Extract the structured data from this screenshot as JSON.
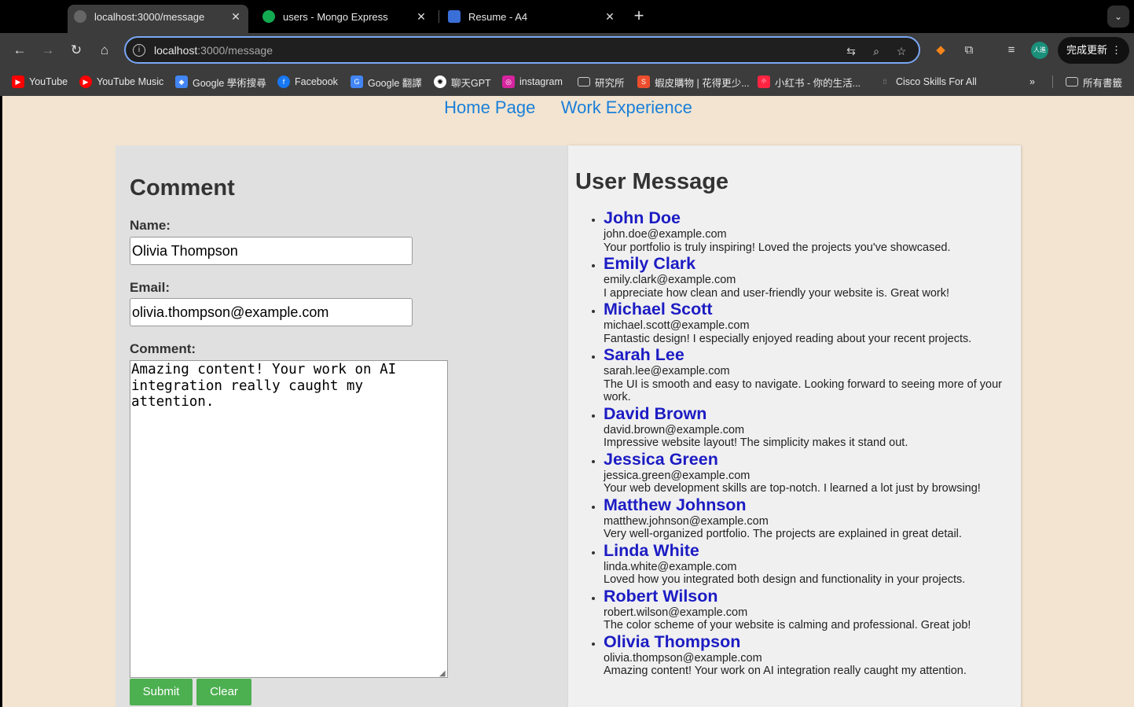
{
  "browser": {
    "tabs": [
      {
        "title": "localhost:3000/message",
        "active": true,
        "favicon": "globe-icon"
      },
      {
        "title": "users - Mongo Express",
        "active": false,
        "favicon": "mongo-leaf-icon"
      },
      {
        "title": "Resume - A4",
        "active": false,
        "favicon": "doc-icon"
      }
    ],
    "url_host": "localhost",
    "url_path": ":3000/message",
    "update_button": "完成更新",
    "profile_initials": "人進",
    "bookmarks": [
      {
        "label": "YouTube",
        "icon": "youtube-icon",
        "color": "#ff0000"
      },
      {
        "label": "YouTube Music",
        "icon": "youtube-music-icon",
        "color": "#ff0000"
      },
      {
        "label": "Google 學術搜尋",
        "icon": "scholar-icon",
        "color": "#4285f4"
      },
      {
        "label": "Facebook",
        "icon": "facebook-icon",
        "color": "#1877f2"
      },
      {
        "label": "Google 翻譯",
        "icon": "translate-icon",
        "color": "#4285f4"
      },
      {
        "label": "聊天GPT",
        "icon": "chatgpt-icon",
        "color": "#ffffff"
      },
      {
        "label": "instagram",
        "icon": "instagram-icon",
        "color": "#d6249f"
      },
      {
        "label": "研究所",
        "icon": "folder-icon",
        "color": "#cccccc"
      },
      {
        "label": "蝦皮購物 | 花得更少...",
        "icon": "shopee-icon",
        "color": "#ee4d2d"
      },
      {
        "label": "小红书 - 你的生活...",
        "icon": "xiaohongshu-icon",
        "color": "#ff2442"
      },
      {
        "label": "Cisco Skills For All",
        "icon": "cisco-icon",
        "color": "#888888"
      }
    ],
    "all_bookmarks": "所有書籤"
  },
  "page": {
    "nav": {
      "home": "Home Page",
      "work": "Work Experience"
    },
    "form": {
      "title": "Comment",
      "name_label": "Name:",
      "name_value": "Olivia Thompson",
      "email_label": "Email:",
      "email_value": "olivia.thompson@example.com",
      "comment_label": "Comment:",
      "comment_value": "Amazing content! Your work on AI integration really caught my attention.",
      "submit": "Submit",
      "clear": "Clear"
    },
    "messages_title": "User Message",
    "messages": [
      {
        "name": "John Doe",
        "email": "john.doe@example.com",
        "text": "Your portfolio is truly inspiring! Loved the projects you've showcased."
      },
      {
        "name": "Emily Clark",
        "email": "emily.clark@example.com",
        "text": "I appreciate how clean and user-friendly your website is. Great work!"
      },
      {
        "name": "Michael Scott",
        "email": "michael.scott@example.com",
        "text": "Fantastic design! I especially enjoyed reading about your recent projects."
      },
      {
        "name": "Sarah Lee",
        "email": "sarah.lee@example.com",
        "text": "The UI is smooth and easy to navigate. Looking forward to seeing more of your work."
      },
      {
        "name": "David Brown",
        "email": "david.brown@example.com",
        "text": "Impressive website layout! The simplicity makes it stand out."
      },
      {
        "name": "Jessica Green",
        "email": "jessica.green@example.com",
        "text": "Your web development skills are top-notch. I learned a lot just by browsing!"
      },
      {
        "name": "Matthew Johnson",
        "email": "matthew.johnson@example.com",
        "text": "Very well-organized portfolio. The projects are explained in great detail."
      },
      {
        "name": "Linda White",
        "email": "linda.white@example.com",
        "text": "Loved how you integrated both design and functionality in your projects."
      },
      {
        "name": "Robert Wilson",
        "email": "robert.wilson@example.com",
        "text": "The color scheme of your website is calming and professional. Great job!"
      },
      {
        "name": "Olivia Thompson",
        "email": "olivia.thompson@example.com",
        "text": "Amazing content! Your work on AI integration really caught my attention."
      }
    ]
  },
  "colors": {
    "page_bg": "#f2e4d0",
    "link": "#1a7fd9",
    "message_name": "#1c1cc4",
    "button": "#4caf50"
  }
}
